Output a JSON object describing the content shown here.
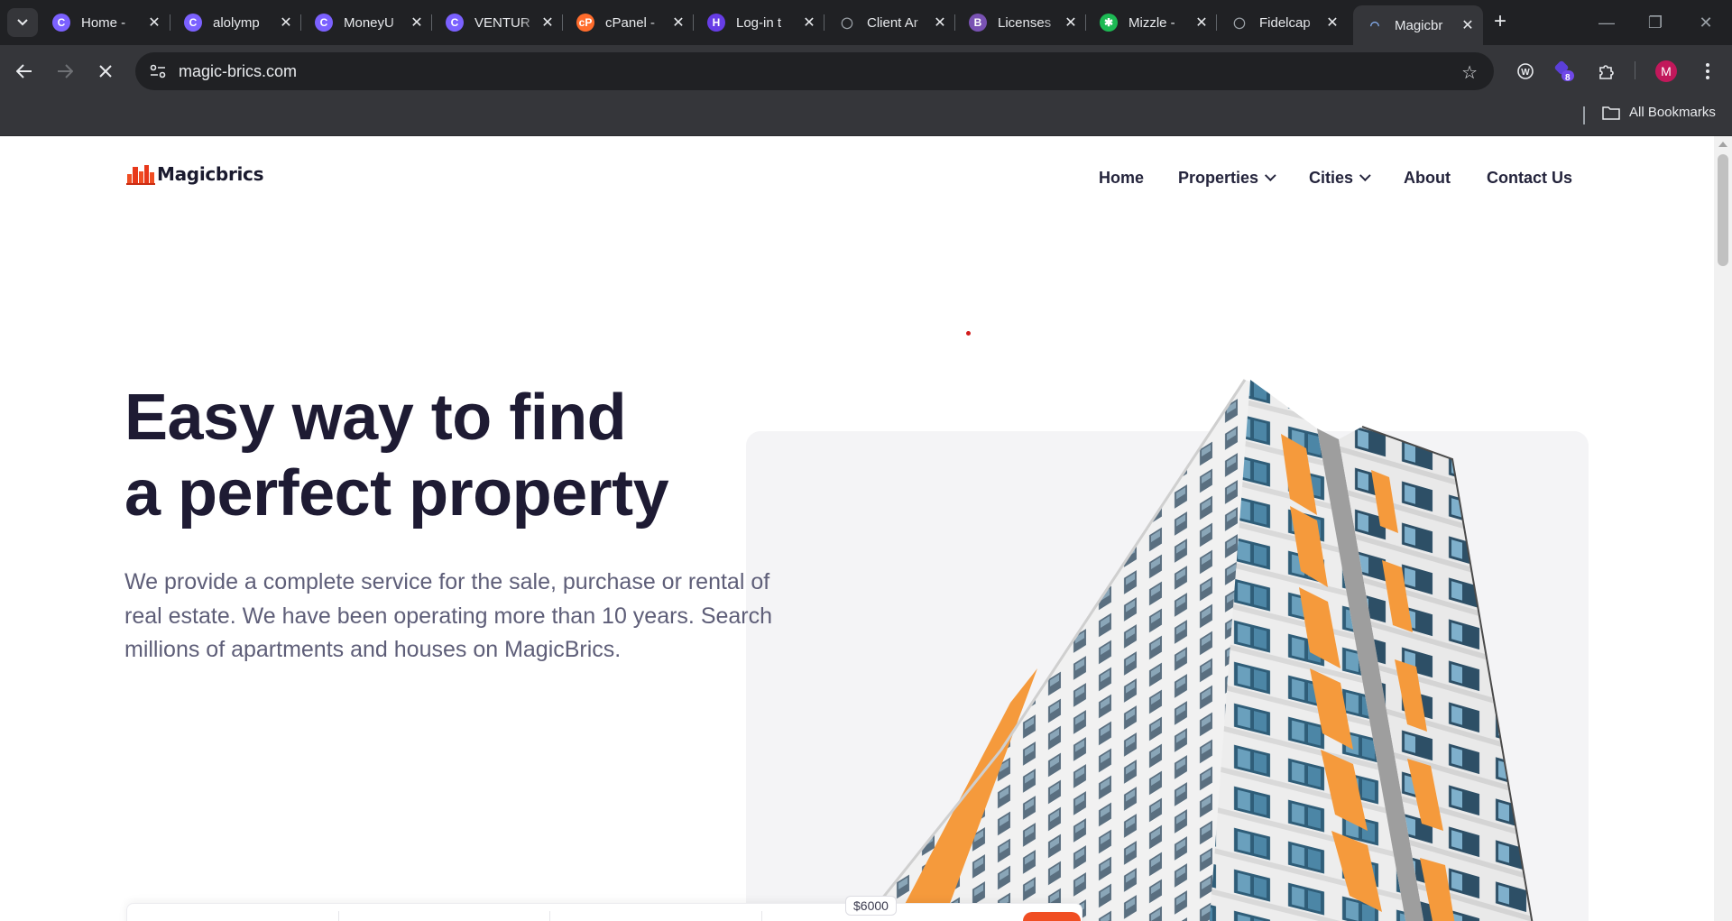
{
  "tabs": [
    {
      "title": "Home - ",
      "favicon": "c-logo-icon",
      "color": "#7b61ff"
    },
    {
      "title": "alolymp",
      "favicon": "c-logo-icon",
      "color": "#7b61ff"
    },
    {
      "title": "MoneyU",
      "favicon": "c-logo-icon",
      "color": "#7b61ff"
    },
    {
      "title": "VENTUR",
      "favicon": "c-logo-icon",
      "color": "#7b61ff"
    },
    {
      "title": "cPanel -",
      "favicon": "cpanel-icon",
      "color": "#ff6c2c"
    },
    {
      "title": "Log-in t",
      "favicon": "h-logo-icon",
      "color": "#673de6"
    },
    {
      "title": "Client Ar",
      "favicon": "globe-icon",
      "color": "#9aa0a6"
    },
    {
      "title": "Licenses",
      "favicon": "b-logo-icon",
      "color": "#7952b3"
    },
    {
      "title": "Mizzle -",
      "favicon": "mizzle-icon",
      "color": "#1db954"
    },
    {
      "title": "Fidelcap",
      "favicon": "globe-icon",
      "color": "#9aa0a6"
    },
    {
      "title": "Magicbr",
      "favicon": "loading-icon",
      "color": "#8ab4f8"
    }
  ],
  "browser": {
    "url": "magic-brics.com",
    "all_bookmarks": "All Bookmarks",
    "extension_badge": "8",
    "profile_initial": "M"
  },
  "site": {
    "logo_text": "Magicbrics",
    "nav": {
      "home": "Home",
      "properties": "Properties",
      "cities": "Cities",
      "about": "About",
      "contact": "Contact Us"
    },
    "hero": {
      "title_line1": "Easy way to find",
      "title_line2": "a perfect property",
      "description": "We provide a complete service for the sale, purchase or rental of real estate. We have been operating more than 10 years. Search millions of apartments and houses on MagicBrics."
    },
    "search": {
      "price_tooltip": "$6000"
    }
  },
  "colors": {
    "accent": "#f04e23",
    "heading": "#1e1b33",
    "body_text": "#5e5e78",
    "building_orange": "#f59a3c"
  }
}
